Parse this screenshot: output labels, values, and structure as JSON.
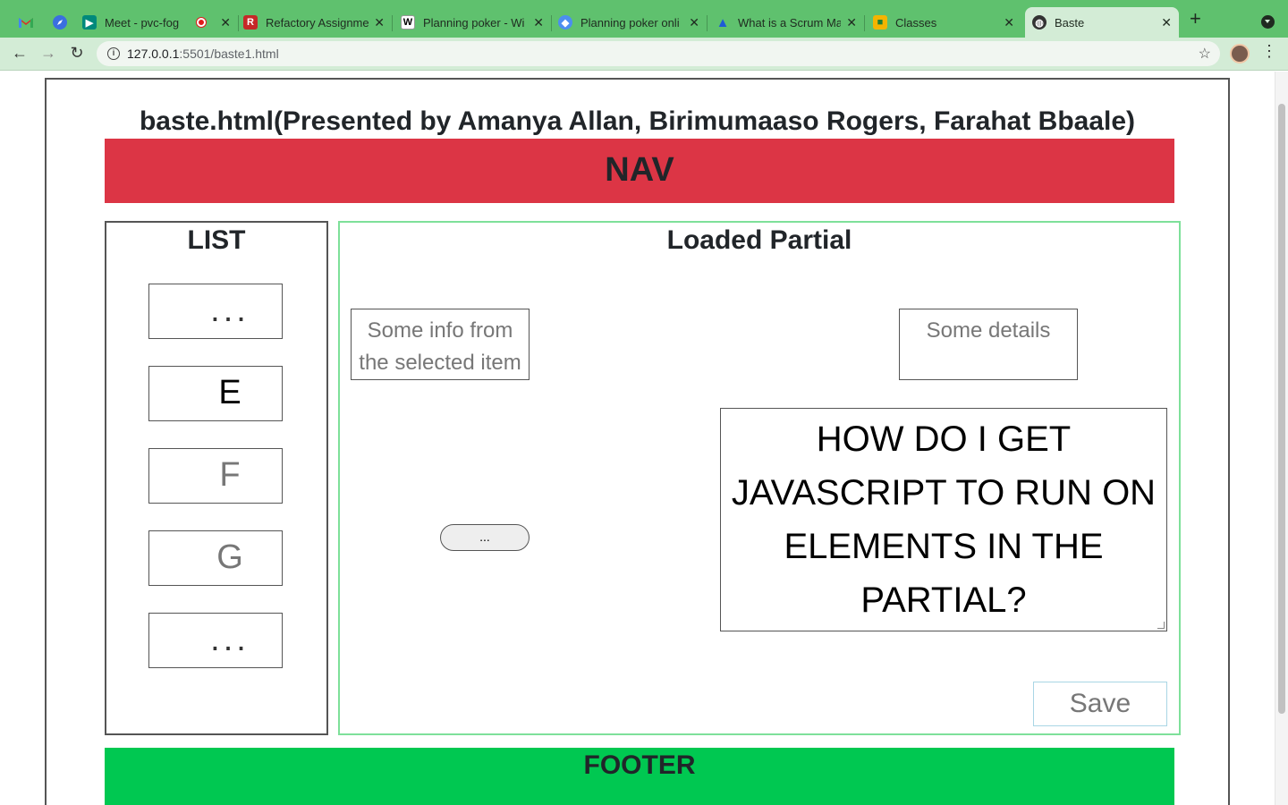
{
  "browser": {
    "tabs": [
      {
        "title": "Meet - pvc-fog",
        "recording": true
      },
      {
        "title": "Refactory Assignme"
      },
      {
        "title": "Planning poker - Wi"
      },
      {
        "title": "Planning poker onli"
      },
      {
        "title": "What is a Scrum Ma"
      },
      {
        "title": "Classes"
      },
      {
        "title": "Baste",
        "active": true
      }
    ],
    "url_host": "127.0.0.1",
    "url_path": ":5501/baste1.html",
    "colors": {
      "tabbar": "#5fc16e",
      "toolbar": "#d3ecd6"
    }
  },
  "page": {
    "title": "baste.html(Presented by Amanya Allan, Birimumaaso Rogers, Farahat Bbaale)",
    "nav_label": "NAV",
    "list": {
      "heading": "LIST",
      "items": [
        {
          "label": "...",
          "color": "#333333"
        },
        {
          "label": "E",
          "color": "#000000"
        },
        {
          "label": "F",
          "color": "#777777"
        },
        {
          "label": "G",
          "color": "#777777"
        },
        {
          "label": "...",
          "color": "#333333"
        }
      ]
    },
    "partial": {
      "heading": "Loaded Partial",
      "info_text": "Some info from the selected item",
      "details_text": "Some details",
      "small_button_label": "...",
      "question": "HOW DO I GET JAVASCRIPT TO RUN ON ELEMENTS IN THE PARTIAL?",
      "save_label": "Save"
    },
    "footer_label": "FOOTER",
    "colors": {
      "nav": "#dc3545",
      "footer": "#00c851",
      "partial_border": "#7ee09a"
    }
  }
}
